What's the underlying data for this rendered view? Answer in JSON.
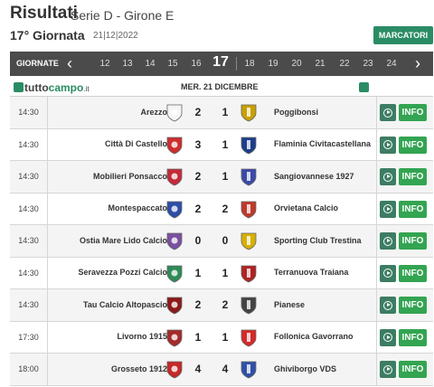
{
  "header": {
    "title": "Risultati",
    "subtitle": "Serie D - Girone E",
    "round": "17° Giornata",
    "date": "21|12|2022",
    "scorers_button": "MARCATORI"
  },
  "nav": {
    "label": "GIORNATE",
    "prev_icon": "chevron-left-icon",
    "next_icon": "chevron-right-icon",
    "before": [
      "12",
      "13",
      "14",
      "15",
      "16"
    ],
    "current": "17",
    "after": [
      "18",
      "19",
      "20",
      "21",
      "22",
      "23",
      "24"
    ]
  },
  "brand": {
    "name_a": "tutto",
    "name_b": "campo",
    "suffix": ".it"
  },
  "day_header": "MER. 21 DICEMBRE",
  "matches": [
    {
      "time": "14:30",
      "home": "Arezzo",
      "home_goals": "2",
      "away_goals": "1",
      "away": "Poggibonsi",
      "home_crest": "#f5f5f5",
      "away_crest": "#c8a000",
      "info": "INFO"
    },
    {
      "time": "14:30",
      "home": "Città Di Castello",
      "home_goals": "3",
      "away_goals": "1",
      "away": "Flaminia Civitacastellana",
      "home_crest": "#cc2e2e",
      "away_crest": "#1d3e8a",
      "info": "INFO"
    },
    {
      "time": "14:30",
      "home": "Mobilieri Ponsacco",
      "home_goals": "2",
      "away_goals": "1",
      "away": "Sangiovannese 1927",
      "home_crest": "#c42a3a",
      "away_crest": "#3b4aa8",
      "info": "INFO"
    },
    {
      "time": "14:30",
      "home": "Montespaccato",
      "home_goals": "2",
      "away_goals": "2",
      "away": "Orvietana Calcio",
      "home_crest": "#2d4ea8",
      "away_crest": "#c0392b",
      "info": "INFO"
    },
    {
      "time": "14:30",
      "home": "Ostia Mare Lido Calcio",
      "home_goals": "0",
      "away_goals": "0",
      "away": "Sporting Club Trestina",
      "home_crest": "#7a4fa0",
      "away_crest": "#d6b000",
      "info": "INFO"
    },
    {
      "time": "14:30",
      "home": "Seravezza Pozzi Calcio",
      "home_goals": "1",
      "away_goals": "1",
      "away": "Terranuova Traiana",
      "home_crest": "#2e8b57",
      "away_crest": "#b22222",
      "info": "INFO"
    },
    {
      "time": "14:30",
      "home": "Tau Calcio Altopascio",
      "home_goals": "2",
      "away_goals": "2",
      "away": "Pianese",
      "home_crest": "#8b1a1a",
      "away_crest": "#444444",
      "info": "INFO"
    },
    {
      "time": "17:30",
      "home": "Livorno 1915",
      "home_goals": "1",
      "away_goals": "1",
      "away": "Follonica Gavorrano",
      "home_crest": "#a52a2a",
      "away_crest": "#d62828",
      "info": "INFO"
    },
    {
      "time": "18:00",
      "home": "Grosseto 1912",
      "home_goals": "4",
      "away_goals": "4",
      "away": "Ghiviborgo VDS",
      "home_crest": "#c62828",
      "away_crest": "#3050a8",
      "info": "INFO"
    }
  ]
}
